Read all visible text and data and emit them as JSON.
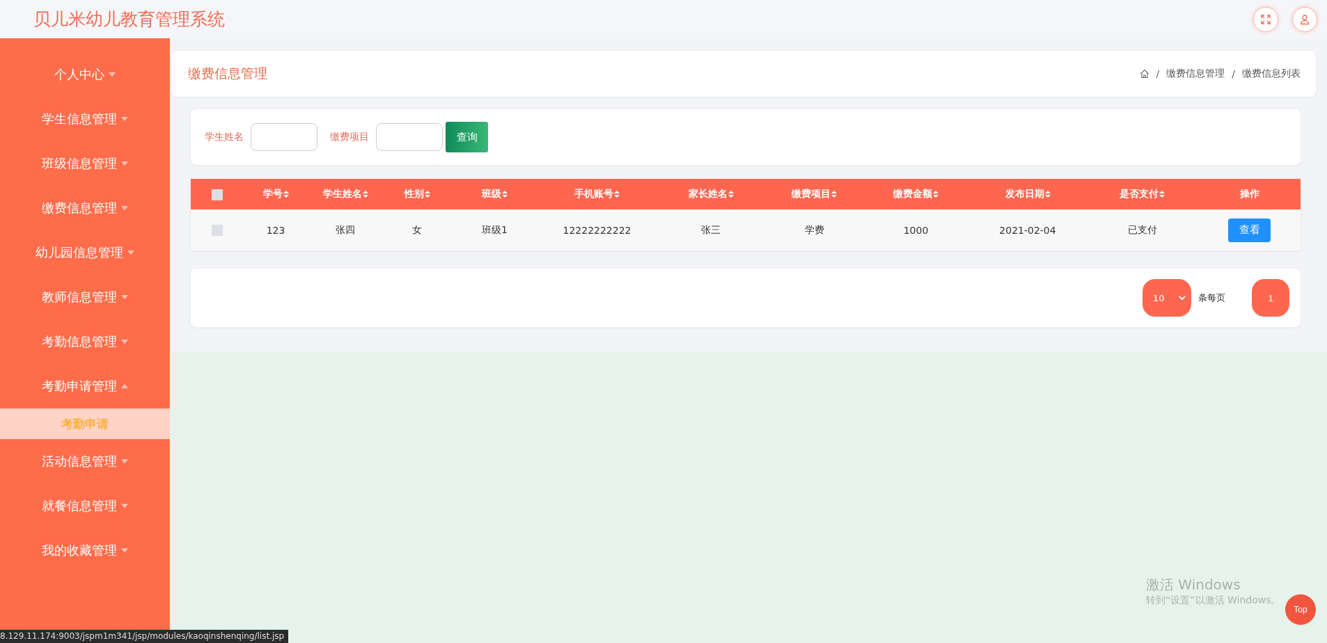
{
  "header": {
    "title": "贝儿米幼儿教育管理系统"
  },
  "sidebar": {
    "items": [
      {
        "label": "个人中心",
        "expanded": false
      },
      {
        "label": "学生信息管理",
        "expanded": false
      },
      {
        "label": "班级信息管理",
        "expanded": false
      },
      {
        "label": "缴费信息管理",
        "expanded": false
      },
      {
        "label": "幼儿园信息管理",
        "expanded": false
      },
      {
        "label": "教师信息管理",
        "expanded": false
      },
      {
        "label": "考勤信息管理",
        "expanded": false
      },
      {
        "label": "考勤申请管理",
        "expanded": true,
        "children": [
          {
            "label": "考勤申请",
            "selected": true
          }
        ]
      },
      {
        "label": "活动信息管理",
        "expanded": false
      },
      {
        "label": "就餐信息管理",
        "expanded": false
      },
      {
        "label": "我的收藏管理",
        "expanded": false
      }
    ]
  },
  "page_header": {
    "title": "缴费信息管理",
    "breadcrumb": [
      "缴费信息管理",
      "缴费信息列表"
    ],
    "separator": "/"
  },
  "search": {
    "fields": [
      {
        "label": "学生姓名"
      },
      {
        "label": "缴费项目"
      }
    ],
    "button": "查询"
  },
  "table": {
    "columns": [
      {
        "label": "学号",
        "sortable": true
      },
      {
        "label": "学生姓名",
        "sortable": true
      },
      {
        "label": "性别",
        "sortable": true
      },
      {
        "label": "班级",
        "sortable": true
      },
      {
        "label": "手机账号",
        "sortable": true
      },
      {
        "label": "家长姓名",
        "sortable": true
      },
      {
        "label": "缴费项目",
        "sortable": true
      },
      {
        "label": "缴费金额",
        "sortable": true
      },
      {
        "label": "发布日期",
        "sortable": true
      },
      {
        "label": "是否支付",
        "sortable": true
      },
      {
        "label": "操作",
        "sortable": false
      }
    ],
    "header_checked": false,
    "rows": [
      {
        "checked": false,
        "cells": [
          "123",
          "张四",
          "女",
          "班级1",
          "12222222222",
          "张三",
          "学费",
          "1000",
          "2021-02-04",
          "已支付"
        ],
        "action": "查看"
      }
    ]
  },
  "pagination": {
    "page_size": "10",
    "per_page_label": "条每页",
    "pages": [
      {
        "label": "1",
        "selected": true
      }
    ]
  },
  "back_to_top": "Top",
  "windows_notice": {
    "title": "激活 Windows",
    "subtitle": "转到“设置”以激活 Windows。"
  },
  "status_bar": {
    "url": "8.129.11.174:9003/jspm1m341/jsp/modules/kaoqinshenqing/list.jsp"
  }
}
